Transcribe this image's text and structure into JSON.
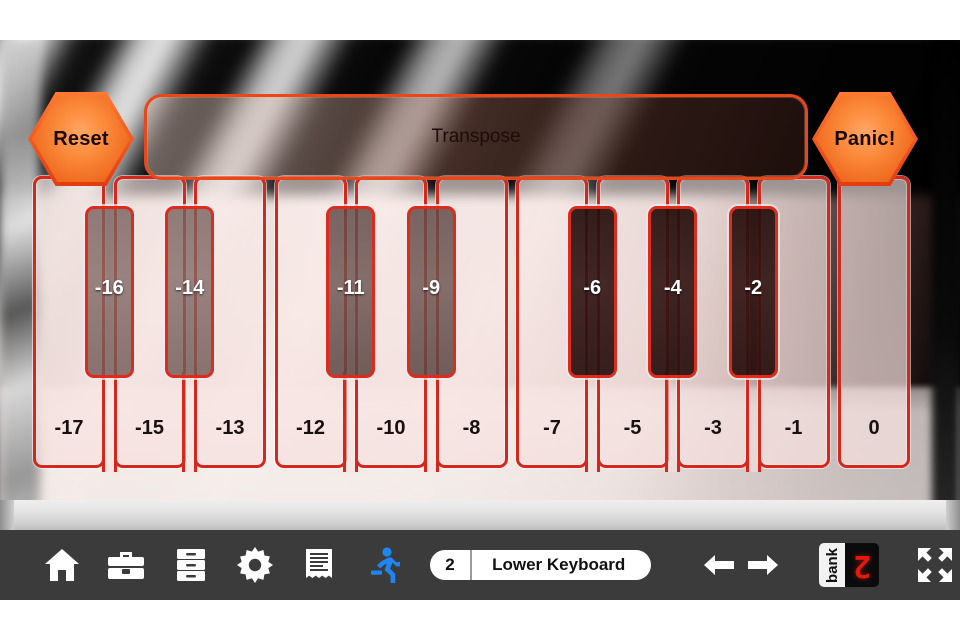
{
  "app": {
    "background_image": "blurred-piano-keys-photo"
  },
  "controls": {
    "reset_label": "Reset",
    "panic_label": "Panic!",
    "transpose_label": "Transpose"
  },
  "keyboard": {
    "white_keys": [
      {
        "label": "-17"
      },
      {
        "label": "-15"
      },
      {
        "label": "-13"
      },
      {
        "label": "-12"
      },
      {
        "label": "-10"
      },
      {
        "label": "-8"
      },
      {
        "label": "-7"
      },
      {
        "label": "-5"
      },
      {
        "label": "-3"
      },
      {
        "label": "-1"
      },
      {
        "label": "0"
      }
    ],
    "black_keys": [
      {
        "label": "-16",
        "shade": "light"
      },
      {
        "label": "-14",
        "shade": "light"
      },
      {
        "label": "-11",
        "shade": "mid"
      },
      {
        "label": "-9",
        "shade": "mid"
      },
      {
        "label": "-6",
        "shade": "dark"
      },
      {
        "label": "-4",
        "shade": "dark"
      },
      {
        "label": "-2",
        "shade": "dark"
      }
    ]
  },
  "toolbar": {
    "icons": [
      {
        "name": "home-icon"
      },
      {
        "name": "toolbox-icon"
      },
      {
        "name": "drawers-icon"
      },
      {
        "name": "gear-icon"
      },
      {
        "name": "document-icon"
      },
      {
        "name": "runner-icon",
        "color": "#1e86f0"
      }
    ],
    "patch_number": "2",
    "patch_name": "Lower Keyboard",
    "prev_label": "←",
    "next_label": "→",
    "bank_label": "bank",
    "bank_value": "2",
    "expand_icon": "fullscreen-icon"
  },
  "colors": {
    "key_border": "#d7261b",
    "accent_orange": "#ef6a1f",
    "toolbar_bg": "#3b3b3b",
    "bank_red": "#e11b0c",
    "runner_blue": "#1e86f0"
  }
}
